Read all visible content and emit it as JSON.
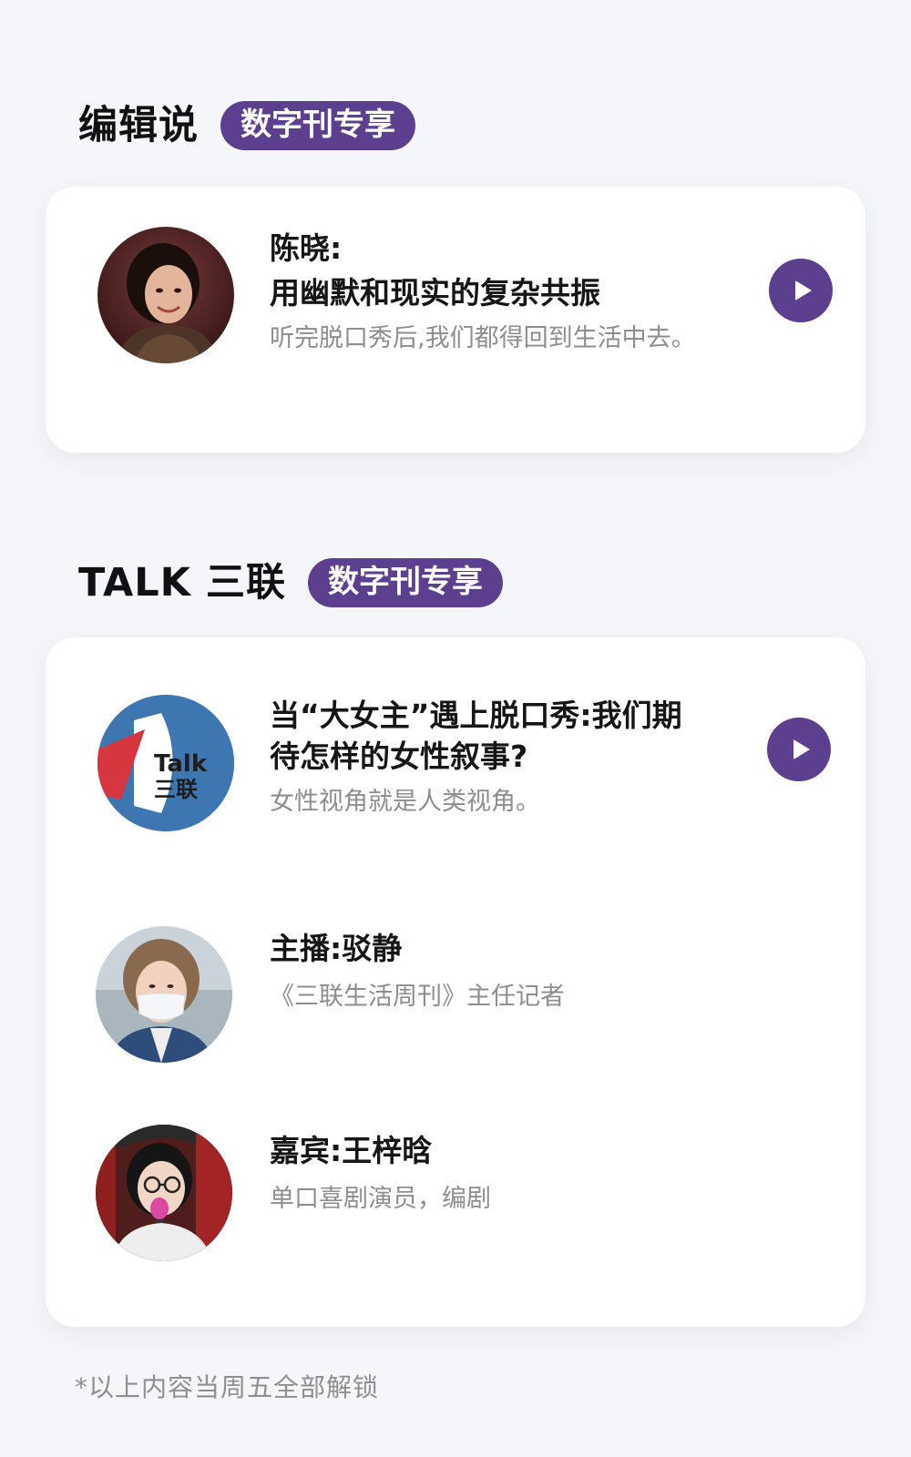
{
  "editor_section": {
    "title": "编辑说",
    "badge": "数字刊专享",
    "card": {
      "author": "陈晓:",
      "headline": "用幽默和现实的复杂共振",
      "description": "听完脱口秀后,我们都得回到生活中去。"
    }
  },
  "talk_section": {
    "title": "TALK 三联",
    "badge": "数字刊专享",
    "episode": {
      "logo_text_top": "Talk",
      "logo_text_bottom": "三联",
      "headline_line1": "当“大女主”遇上脱口秀:我们期",
      "headline_line2": "待怎样的女性叙事?",
      "description": "女性视角就是人类视角。"
    },
    "host": {
      "name": "主播:驳静",
      "role": "《三联生活周刊》主任记者"
    },
    "guest": {
      "name": "嘉宾:王梓晗",
      "role": "单口喜剧演员，编剧"
    }
  },
  "footer": {
    "note": "*以上内容当周五全部解锁"
  },
  "colors": {
    "accent": "#5C3F8F",
    "background": "#F5F6FA",
    "card": "#FFFFFF",
    "muted_text": "#8E8E8E"
  }
}
